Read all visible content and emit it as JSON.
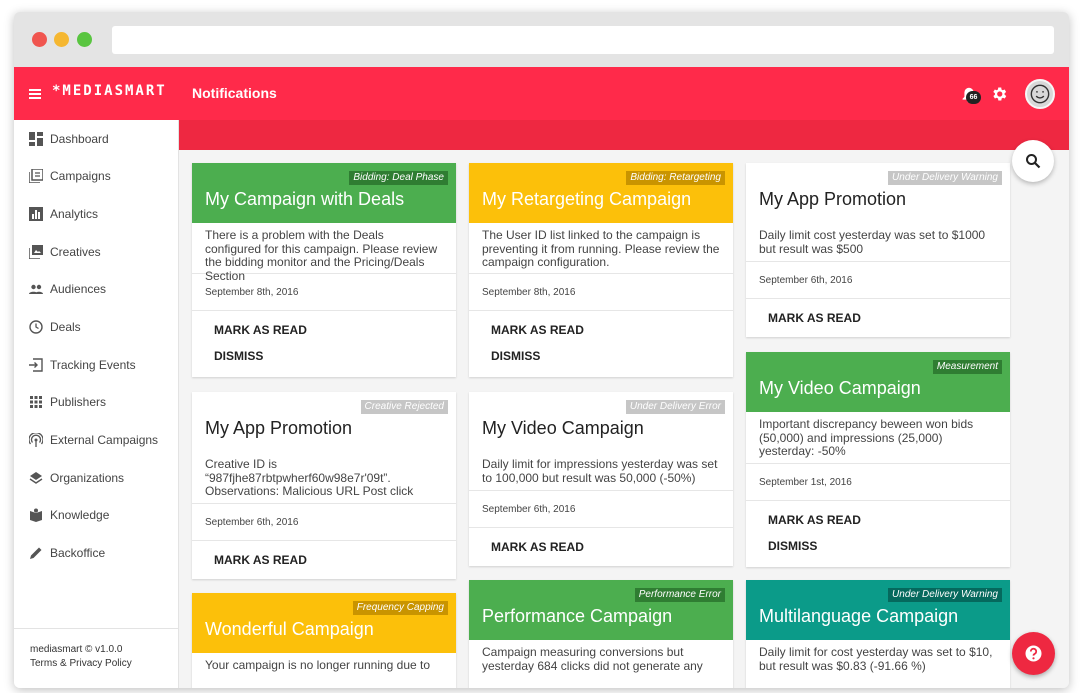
{
  "header": {
    "brand": "*MEDIASMART",
    "title": "Notifications",
    "notification_count": "66"
  },
  "sidebar": {
    "items": [
      {
        "label": "Dashboard",
        "icon": "dashboard-icon"
      },
      {
        "label": "Campaigns",
        "icon": "campaigns-icon"
      },
      {
        "label": "Analytics",
        "icon": "analytics-icon"
      },
      {
        "label": "Creatives",
        "icon": "creatives-icon"
      },
      {
        "label": "Audiences",
        "icon": "audiences-icon"
      },
      {
        "label": "Deals",
        "icon": "clock-icon"
      },
      {
        "label": "Tracking Events",
        "icon": "tracking-icon"
      },
      {
        "label": "Publishers",
        "icon": "grid-icon"
      },
      {
        "label": "External Campaigns",
        "icon": "antenna-icon"
      },
      {
        "label": "Organizations",
        "icon": "layers-icon"
      },
      {
        "label": "Knowledge",
        "icon": "book-icon"
      },
      {
        "label": "Backoffice",
        "icon": "pencil-icon"
      }
    ],
    "footer": {
      "version": "mediasmart © v1.0.0",
      "terms": "Terms",
      "amp": "&",
      "privacy": "Privacy Policy"
    }
  },
  "actions": {
    "mark_as_read": "MARK AS READ",
    "dismiss": "DISMISS"
  },
  "cards": [
    {
      "title": "My Campaign with Deals",
      "tag": "Bidding: Deal Phase",
      "color": "#4cae4f",
      "body": "There is a problem with the Deals configured for this campaign. Please review the bidding monitor and the Pricing/Deals Section",
      "date": "September 8th, 2016"
    },
    {
      "title": "My Retargeting Campaign",
      "tag": "Bidding: Retargeting",
      "color": "#fcc00a",
      "body": "The User ID list linked to the campaign is preventing it from running. Please review the campaign configuration.",
      "date": "September 8th, 2016"
    },
    {
      "title": "My App Promotion",
      "tag": "Under Delivery Warning",
      "color": "#ffffff",
      "body": "Daily limit cost yesterday was set to $1000 but result was $500",
      "date": "September 6th, 2016"
    },
    {
      "title": "My App Promotion",
      "tag": "Creative Rejected",
      "color": "#ffffff",
      "body": "Creative ID is “987fjhe87rbtpwherf60w98e7r'09t”. Observations: Malicious URL Post click",
      "date": "September 6th, 2016"
    },
    {
      "title": "My Video Campaign",
      "tag": "Under Delivery Error",
      "color": "#ffffff",
      "body": "Daily limit for impressions yesterday was set to 100,000 but result was 50,000 (-50%)",
      "date": "September 6th, 2016"
    },
    {
      "title": "My Video Campaign",
      "tag": "Measurement",
      "color": "#4cae4f",
      "body": "Important discrepancy beween won bids (50,000) and impressions (25,000) yesterday: -50%",
      "date": "September 1st, 2016"
    },
    {
      "title": "Wonderful Campaign",
      "tag": "Frequency Capping",
      "color": "#fcc00a",
      "body": "Your campaign is no longer running due to"
    },
    {
      "title": "Performance Campaign",
      "tag": "Performance Error",
      "color": "#4cae4f",
      "body": "Campaign measuring conversions but yesterday 684 clicks did not generate any"
    },
    {
      "title": "Multilanguage Campaign",
      "tag": "Under Delivery Warning",
      "color": "#0b9b89",
      "body": "Daily limit for cost yesterday was set to $10, but result was $0.83 (-91.66 %)"
    }
  ]
}
